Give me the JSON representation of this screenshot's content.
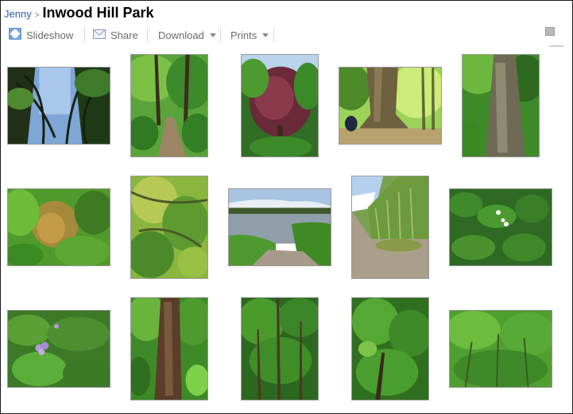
{
  "header": {
    "owner": "Jenny",
    "separator": ">",
    "title": "Inwood Hill Park"
  },
  "toolbar": {
    "slideshow": "Slideshow",
    "share": "Share",
    "download": "Download",
    "prints": "Prints"
  },
  "colors": {
    "link": "#2a5db0",
    "toolbar_text": "#6b6b6b",
    "icon_blue": "#3a78c6"
  },
  "photos": [
    {
      "name": "photo-trees-sky-1"
    },
    {
      "name": "photo-forest-path"
    },
    {
      "name": "photo-red-leaf-tree"
    },
    {
      "name": "photo-large-trunk-sunlight"
    },
    {
      "name": "photo-tall-trunk"
    },
    {
      "name": "photo-canopy-autumn"
    },
    {
      "name": "photo-leafy-branches"
    },
    {
      "name": "photo-hudson-river-view"
    },
    {
      "name": "photo-cliff-grass"
    },
    {
      "name": "photo-white-flowers"
    },
    {
      "name": "photo-purple-flower"
    },
    {
      "name": "photo-tree-trunk-green"
    },
    {
      "name": "photo-thicket"
    },
    {
      "name": "photo-leafy-shrub"
    },
    {
      "name": "photo-green-ferns"
    }
  ]
}
